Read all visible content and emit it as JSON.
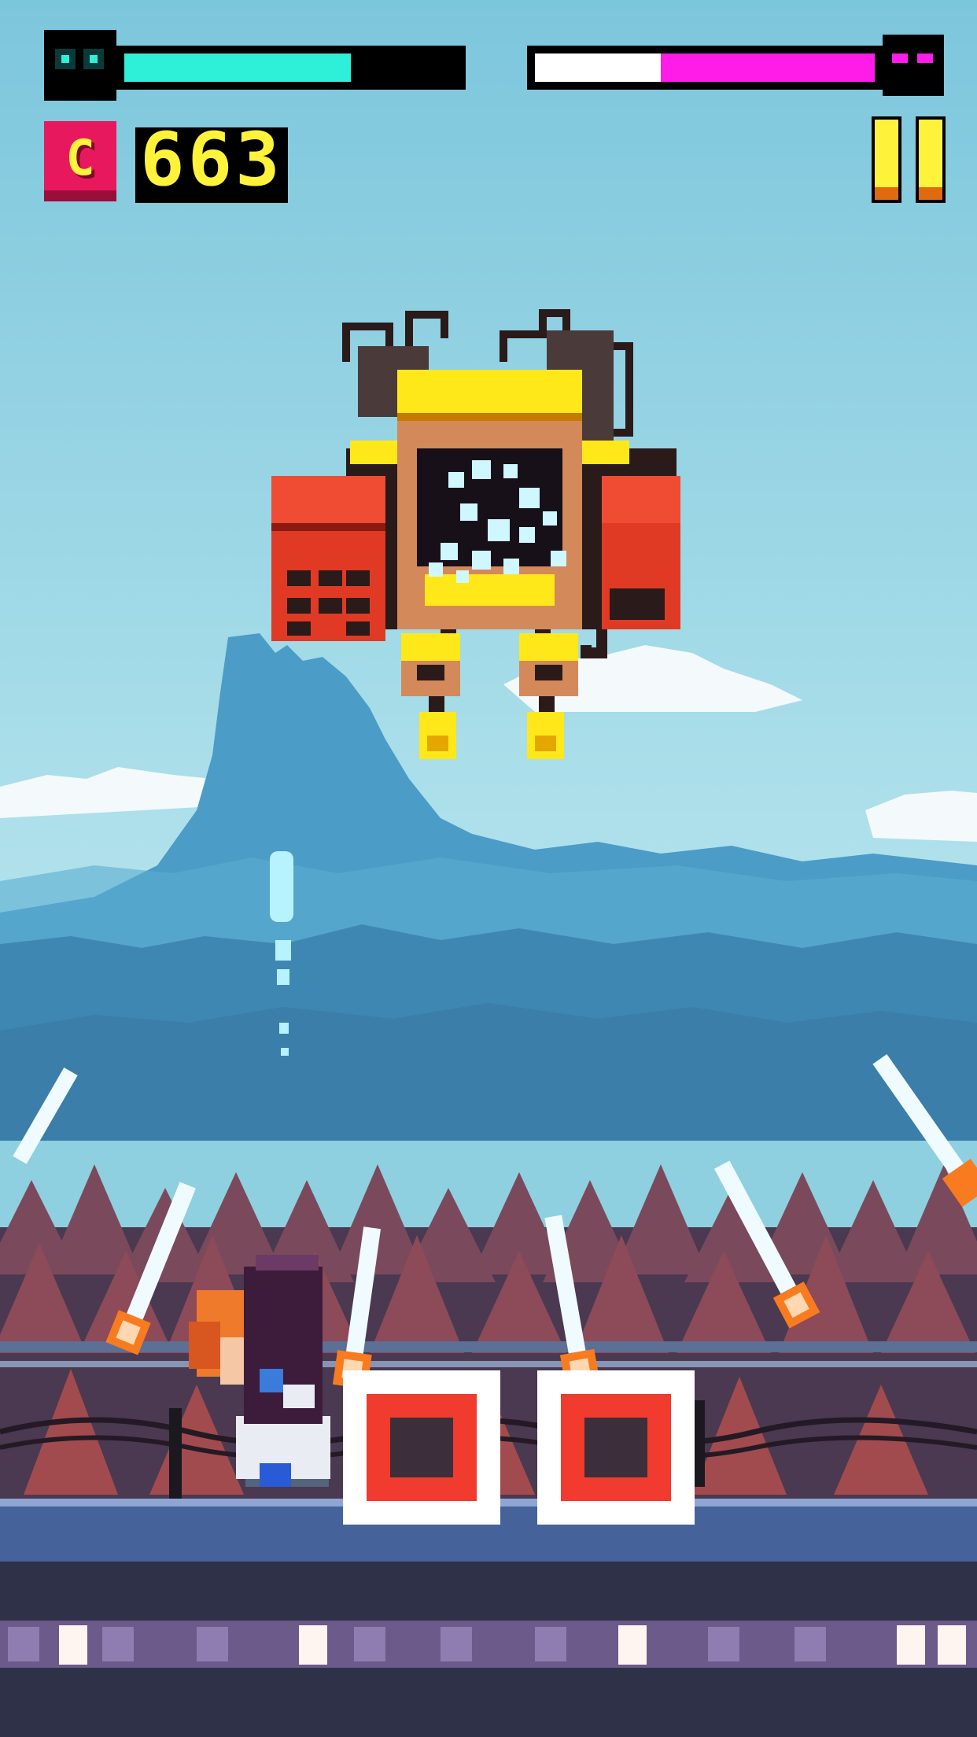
{
  "game": {
    "player_health_percent": 68,
    "boss_health_percent": 63,
    "boss_health_lost_percent": 37,
    "coin_letter": "C",
    "score": "663"
  },
  "colors": {
    "player_health": "#2ef0d8",
    "boss_health": "#ff1be8",
    "score_text": "#fff23b",
    "coin_bg": "#e8185f",
    "sky_top": "#7cc6dc",
    "sky_bottom": "#b9e6ee"
  },
  "icons": {
    "player_icon": "robot-face-icon",
    "boss_icon": "robot-face-icon",
    "coin_icon": "coin-icon",
    "pause_icon": "pause-icon"
  }
}
